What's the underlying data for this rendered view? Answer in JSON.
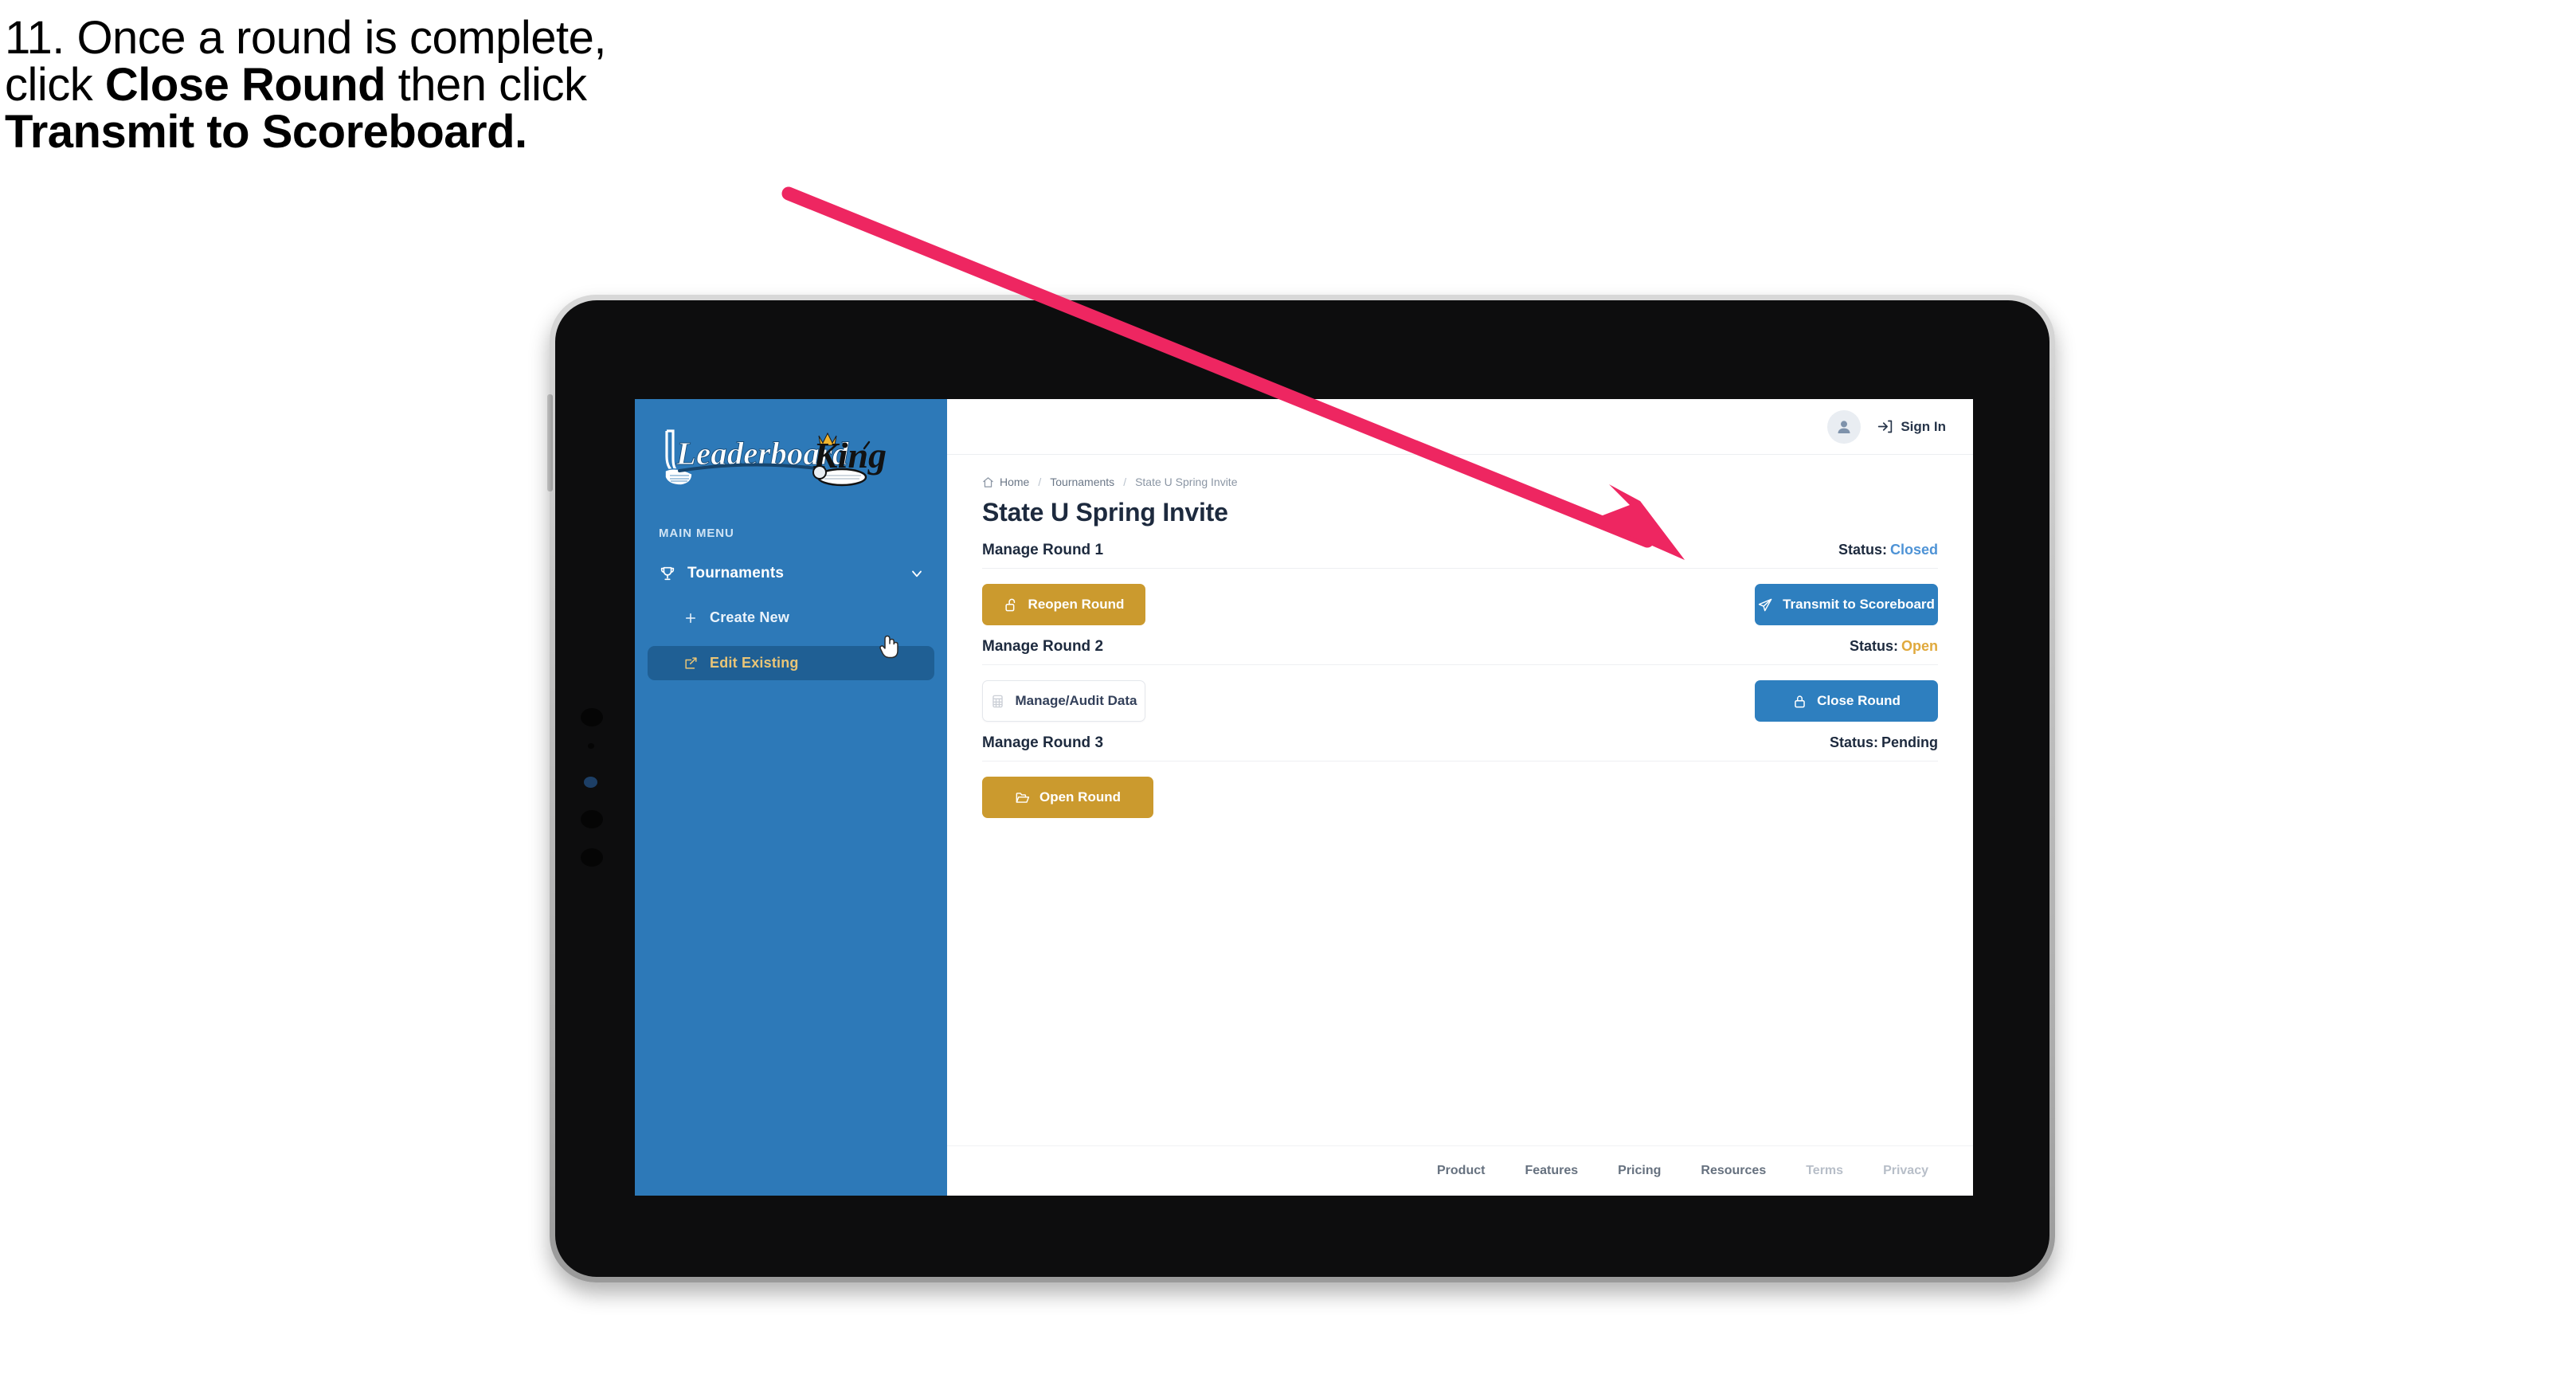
{
  "caption": {
    "line1": "11. Once a round is complete,",
    "line2_pre": "click ",
    "line2_bold": "Close Round",
    "line2_post": " then click",
    "line3_bold": "Transmit to Scoreboard."
  },
  "colors": {
    "sidebar_blue": "#2D79B8",
    "sidebar_active_blue": "#1F5F94",
    "sidebar_active_text": "#E9C577",
    "button_blue": "#2E7FBF",
    "button_gold": "#CB9A2E",
    "status_closed": "#4E93D6",
    "status_open": "#E0A93C",
    "status_pending": "#1D2A3E",
    "arrow_pink": "#EE2661",
    "title_navy": "#1D2A3E"
  },
  "sidebar": {
    "logo_text_primary": "Leaderboard",
    "logo_text_secondary": "King",
    "logo_icon": "golf-club-icon",
    "crown_icon": "crown-icon",
    "section_label": "MAIN MENU",
    "items": [
      {
        "label": "Tournaments",
        "icon": "trophy-icon",
        "chevron": "chevron-down-icon",
        "active": false
      },
      {
        "label": "Create New",
        "icon": "plus-icon",
        "active": false
      },
      {
        "label": "Edit Existing",
        "icon": "edit-square-icon",
        "active": true
      }
    ],
    "cursor_icon": "hand-pointer-cursor"
  },
  "topbar": {
    "avatar_icon": "user-avatar-icon",
    "signin_icon": "sign-in-arrow-icon",
    "signin_label": "Sign In"
  },
  "breadcrumb": {
    "home_icon": "home-icon",
    "items": [
      "Home",
      "Tournaments",
      "State U Spring Invite"
    ],
    "separator": "/"
  },
  "page": {
    "title": "State U Spring Invite"
  },
  "rounds": [
    {
      "title": "Manage Round 1",
      "status_label": "Status:",
      "status_value": "Closed",
      "status_class": "st-closed",
      "left_button": {
        "label": "Reopen Round",
        "icon": "unlock-icon",
        "style": "btn-gold",
        "width": "w-reopen"
      },
      "right_button": {
        "label": "Transmit to Scoreboard",
        "icon": "paper-plane-icon",
        "style": "btn-blue",
        "width": "w-transmit"
      }
    },
    {
      "title": "Manage Round 2",
      "status_label": "Status:",
      "status_value": "Open",
      "status_class": "st-open",
      "left_button": {
        "label": "Manage/Audit Data",
        "icon": "table-grid-icon",
        "style": "btn-ghost",
        "width": "w-audit"
      },
      "right_button": {
        "label": "Close Round",
        "icon": "lock-icon",
        "style": "btn-blue",
        "width": "w-close"
      }
    },
    {
      "title": "Manage Round 3",
      "status_label": "Status:",
      "status_value": "Pending",
      "status_class": "st-pending",
      "left_button": {
        "label": "Open Round",
        "icon": "folder-open-icon",
        "style": "btn-gold",
        "width": "w-open"
      },
      "right_button": null
    }
  ],
  "footer": {
    "links": [
      {
        "label": "Product",
        "muted": false
      },
      {
        "label": "Features",
        "muted": false
      },
      {
        "label": "Pricing",
        "muted": false
      },
      {
        "label": "Resources",
        "muted": false
      },
      {
        "label": "Terms",
        "muted": true
      },
      {
        "label": "Privacy",
        "muted": true
      }
    ]
  },
  "annotation": {
    "arrow_icon": "pointer-arrow-annotation",
    "target": "Transmit to Scoreboard"
  }
}
